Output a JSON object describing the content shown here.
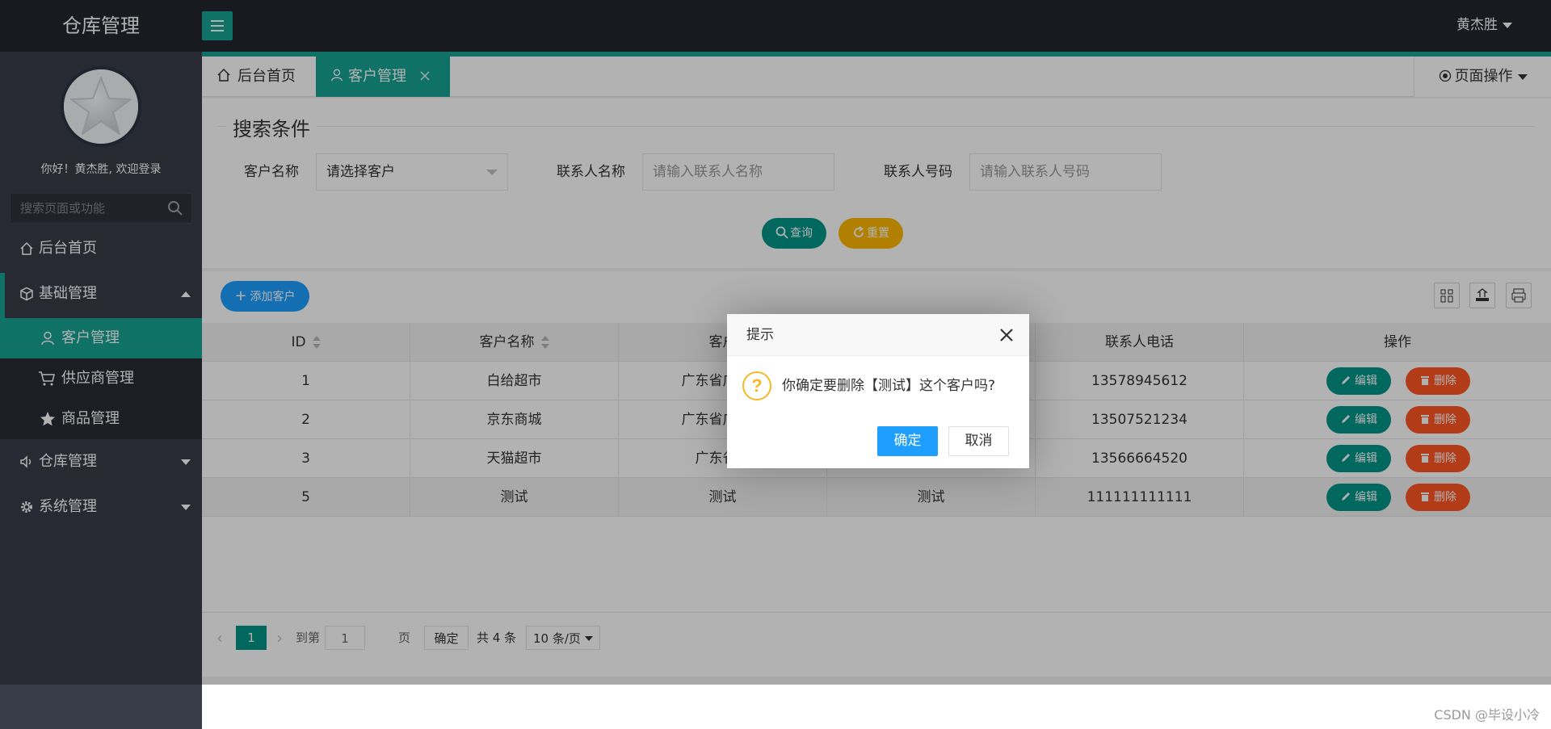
{
  "app": {
    "title": "仓库管理",
    "user": "黄杰胜"
  },
  "sidebar": {
    "welcome": "你好！黄杰胜, 欢迎登录",
    "search_placeholder": "搜索页面或功能",
    "items": [
      {
        "label": "后台首页",
        "icon": "home-icon"
      },
      {
        "label": "基础管理",
        "icon": "cube-icon",
        "expanded": true
      },
      {
        "label": "仓库管理",
        "icon": "speaker-icon"
      },
      {
        "label": "系统管理",
        "icon": "gear-icon"
      }
    ],
    "sub_items": [
      {
        "label": "客户管理",
        "icon": "user-icon",
        "active": true
      },
      {
        "label": "供应商管理",
        "icon": "cart-icon"
      },
      {
        "label": "商品管理",
        "icon": "star-icon"
      }
    ]
  },
  "tabs": [
    {
      "label": "后台首页",
      "icon": "home-icon"
    },
    {
      "label": "客户管理",
      "icon": "user-icon",
      "active": true
    }
  ],
  "page_ops": "页面操作",
  "search": {
    "legend": "搜索条件",
    "customer_label": "客户名称",
    "customer_placeholder": "请选择客户",
    "contact_label": "联系人名称",
    "contact_placeholder": "请输入联系人名称",
    "phone_label": "联系人号码",
    "phone_placeholder": "请输入联系人号码",
    "query_btn": "查询",
    "reset_btn": "重置"
  },
  "table": {
    "add_btn": "添加客户",
    "headers": [
      "ID",
      "客户名称",
      "客户",
      "",
      "联系人电话",
      "操作"
    ],
    "rows": [
      {
        "id": "1",
        "name": "白给超市",
        "addr": "广东省广州市",
        "contact": "",
        "phone": "13578945612"
      },
      {
        "id": "2",
        "name": "京东商城",
        "addr": "广东省广州市",
        "contact": "",
        "phone": "13507521234"
      },
      {
        "id": "3",
        "name": "天猫超市",
        "addr": "广东省东",
        "contact": "",
        "phone": "13566664520"
      },
      {
        "id": "5",
        "name": "测试",
        "addr": "测试",
        "contact": "测试",
        "phone": "111111111111"
      }
    ],
    "edit_label": "编辑",
    "delete_label": "删除"
  },
  "pager": {
    "current": "1",
    "goto_prefix": "到第",
    "goto_value": "1",
    "goto_suffix": "页",
    "confirm": "确定",
    "total": "共 4 条",
    "page_size": "10 条/页"
  },
  "dialog": {
    "title": "提示",
    "message": "你确定要删除【测试】这个客户吗?",
    "ok": "确定",
    "cancel": "取消"
  },
  "watermark": "CSDN @毕设小冷",
  "colors": {
    "teal": "#17a294",
    "blue": "#1e9fff",
    "orange": "#ff5722",
    "yellow": "#ffb800",
    "dark": "#23262e"
  }
}
